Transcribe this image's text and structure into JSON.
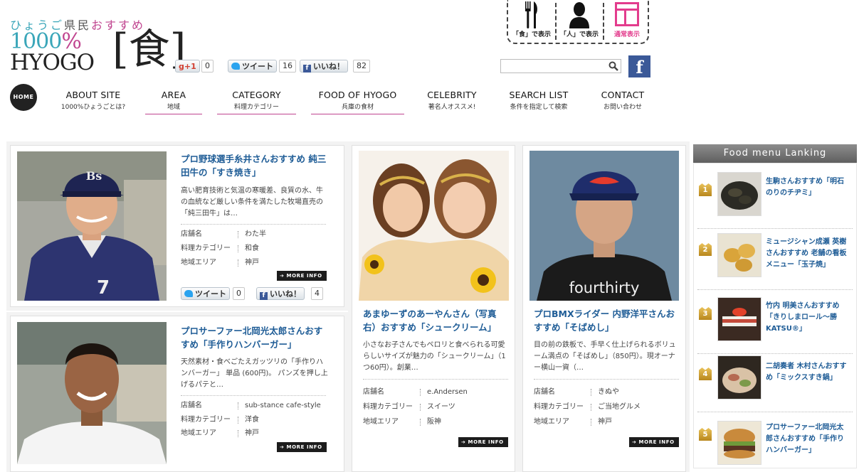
{
  "logo": {
    "tagline_1": "ひょうご",
    "tagline_2": "県民",
    "tagline_3": "おすすめ",
    "line1_num": "1000",
    "line1_pct": "%",
    "line2": "HYOGO",
    "kanji": "[食]"
  },
  "social": {
    "gplus_label": "+1",
    "gplus_count": "0",
    "tweet_label": "ツイート",
    "tweet_count": "16",
    "like_label": "いいね！",
    "like_count": "82"
  },
  "display_modes": {
    "food": "「食」で表示",
    "person": "「人」で表示",
    "normal": "通常表示"
  },
  "search": {
    "placeholder": ""
  },
  "nav": {
    "home": "HOME",
    "items": [
      {
        "en": "ABOUT SITE",
        "jp": "1000%ひょうごとは?"
      },
      {
        "en": "AREA",
        "jp": "地域"
      },
      {
        "en": "CATEGORY",
        "jp": "料理カテゴリー"
      },
      {
        "en": "FOOD OF HYOGO",
        "jp": "兵庫の食材"
      },
      {
        "en": "CELEBRITY",
        "jp": "著名人オススメ!"
      },
      {
        "en": "SEARCH LIST",
        "jp": "条件を指定して検索"
      },
      {
        "en": "CONTACT",
        "jp": "お問い合わせ"
      }
    ]
  },
  "labels": {
    "shop": "店舗名",
    "category": "料理カテゴリー",
    "area": "地域エリア",
    "more": "MORE INFO",
    "tweet": "ツイート",
    "like": "いいね！"
  },
  "cards": [
    {
      "title": "プロ野球選手糸井さんおすすめ 純三田牛の「すき焼き」",
      "desc": "高い肥育技術と気温の寒暖差、良質の水、牛の血統など厳しい条件を満たした牧場直売の「純三田牛」は…",
      "shop": "わた半",
      "category": "和食",
      "area": "神戸",
      "tweet_count": "0",
      "like_count": "4"
    },
    {
      "title": "プロサーファー北岡光太郎さんおすすめ「手作りハンバーガー」",
      "desc": "天然素材・食べごたえガッツリの「手作りハンバーガー」 単品 (600円)。 パンズを押し上げるパテと…",
      "shop": "sub-stance cafe-style",
      "category": "洋食",
      "area": "神戸"
    },
    {
      "title": "あまゆーずのあーやんさん（写真右）おすすめ「シュークリーム」",
      "desc": "小さなお子さんでもペロリと食べられる可愛らしいサイズが魅力の「シュークリーム」（1つ60円）。創業…",
      "shop": "e.Andersen",
      "category": "スイーツ",
      "area": "阪神"
    },
    {
      "title": "プロBMXライダー 内野洋平さんおすすめ「そばめし」",
      "desc": "目の前の鉄板で、手早く仕上げられるボリューム満点の「そばめし」（850円）。現オーナー横山一資（…",
      "shop": "きぬや",
      "category": "ご当地グルメ",
      "area": "神戸",
      "shirt_text": "fourthirty"
    }
  ],
  "ranking": {
    "title": "Food menu Lanking",
    "items": [
      {
        "rank": "1",
        "text": "生駒さんおすすめ「明石のりのチヂミ」"
      },
      {
        "rank": "2",
        "text": "ミュージシャン成瀬 英樹さんおすすめ 老舗の看板メニュー「玉子焼」"
      },
      {
        "rank": "3",
        "text": "竹内 明美さんおすすめ「きりしまロール～勝KATSU®」"
      },
      {
        "rank": "4",
        "text": "二胡奏者 木村さんおすすめ「ミックスすき鍋」"
      },
      {
        "rank": "5",
        "text": "プロサーファー北岡光太郎さんおすすめ「手作りハンバーガー」"
      }
    ]
  },
  "colors": {
    "link_blue": "#1e5c96",
    "accent_pink": "#c0448f",
    "facebook": "#3b5998",
    "twitter": "#2aa3ef",
    "medal_gold": "#d2a13c"
  }
}
